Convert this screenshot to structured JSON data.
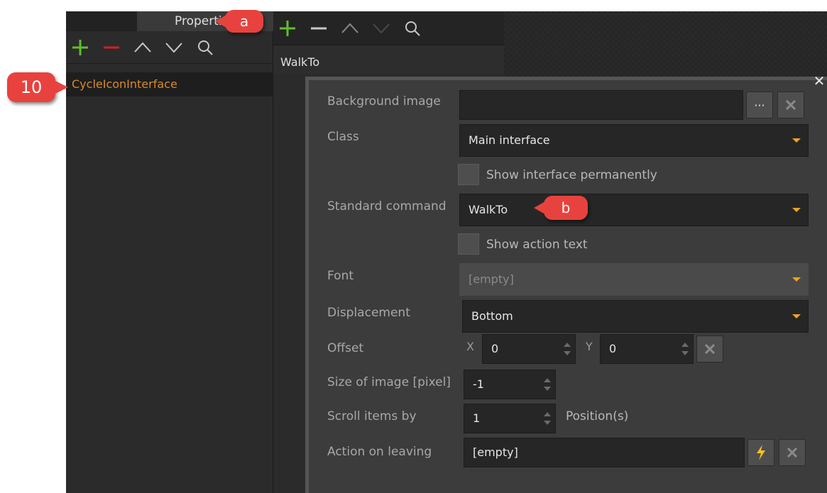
{
  "left_panel": {
    "title": "Properties",
    "items": [
      "CycleIconInterface"
    ]
  },
  "middle_panel": {
    "header": "WalkTo"
  },
  "dialog": {
    "background_image": {
      "label": "Background image",
      "value": "",
      "browse_label": "···"
    },
    "class": {
      "label": "Class",
      "value": "Main interface"
    },
    "show_permanently": {
      "label": "Show interface permanently",
      "checked": false
    },
    "standard_command": {
      "label": "Standard command",
      "value": "WalkTo"
    },
    "show_action_text": {
      "label": "Show action text",
      "checked": false
    },
    "font": {
      "label": "Font",
      "value": "[empty]"
    },
    "displacement": {
      "label": "Displacement",
      "value": "Bottom"
    },
    "offset": {
      "label": "Offset",
      "x_label": "X",
      "x_value": "0",
      "y_label": "Y",
      "y_value": "0"
    },
    "image_size": {
      "label": "Size of image [pixel]",
      "value": "-1"
    },
    "scroll_items": {
      "label": "Scroll items by",
      "value": "1",
      "suffix": "Position(s)"
    },
    "action_on_leaving": {
      "label": "Action on leaving",
      "value": "[empty]"
    }
  },
  "callouts": {
    "a": "a",
    "b": "b",
    "ten": "10"
  },
  "colors": {
    "accent": "#f1a21b",
    "callout": "#e8423e",
    "add": "#5fbf2a",
    "remove": "#d02020",
    "tree_item_text": "#d88a2a"
  },
  "icons": [
    "plus-icon",
    "minus-icon",
    "chevron-up-icon",
    "chevron-down-icon",
    "search-icon",
    "close-icon",
    "lightning-icon"
  ]
}
